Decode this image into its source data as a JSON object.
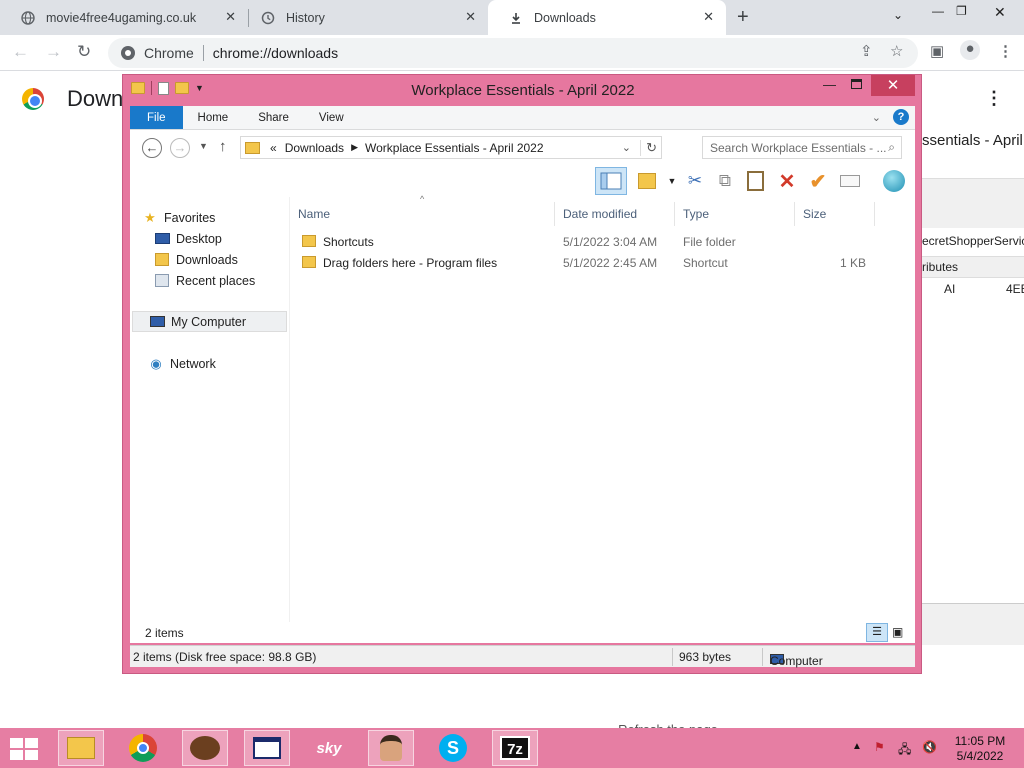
{
  "browser": {
    "tabs": [
      {
        "title": "movie4free4ugaming.co.uk",
        "icon": "globe-icon"
      },
      {
        "title": "History",
        "icon": "history-icon"
      },
      {
        "title": "Downloads",
        "icon": "download-icon"
      }
    ],
    "address_site": "Chrome",
    "address_url": "chrome://downloads",
    "page_title": "Down",
    "background_title": "ssentials - April",
    "background_rows": [
      "ecretShopperServic",
      "ributes"
    ],
    "background_cells": [
      "AI",
      "4EB"
    ],
    "background_refresh": "Refresh the page."
  },
  "explorer": {
    "title": "Workplace Essentials - April 2022",
    "ribbon_tabs": [
      "File",
      "Home",
      "Share",
      "View"
    ],
    "breadcrumb": [
      "«",
      "Downloads",
      "Workplace Essentials - April 2022"
    ],
    "search_placeholder": "Search Workplace Essentials - ...",
    "nav": {
      "favorites": "Favorites",
      "desktop": "Desktop",
      "downloads": "Downloads",
      "recent": "Recent places",
      "computer": "My Computer",
      "network": "Network"
    },
    "columns": [
      "Name",
      "Date modified",
      "Type",
      "Size"
    ],
    "files": [
      {
        "name": "Shortcuts",
        "date": "5/1/2022 3:04 AM",
        "type": "File folder",
        "size": ""
      },
      {
        "name": "Drag folders here - Program files",
        "date": "5/1/2022 2:45 AM",
        "type": "Shortcut",
        "size": "1 KB"
      }
    ],
    "item_count": "2 items",
    "status_left": "2 items (Disk free space: 98.8 GB)",
    "status_bytes": "963 bytes",
    "status_location": "Computer"
  },
  "taskbar": {
    "apps": [
      "file-explorer-icon",
      "chrome-icon",
      "coffee-bean-icon",
      "window-icon",
      "sky-icon",
      "person-icon",
      "skype-icon",
      "7zip-icon"
    ],
    "time": "11:05 PM",
    "date": "5/4/2022"
  },
  "colors": {
    "window_frame": "#e6779f",
    "ribbon_file": "#1979ca",
    "taskbar": "#e67ea3",
    "close_button": "#c7405f"
  }
}
